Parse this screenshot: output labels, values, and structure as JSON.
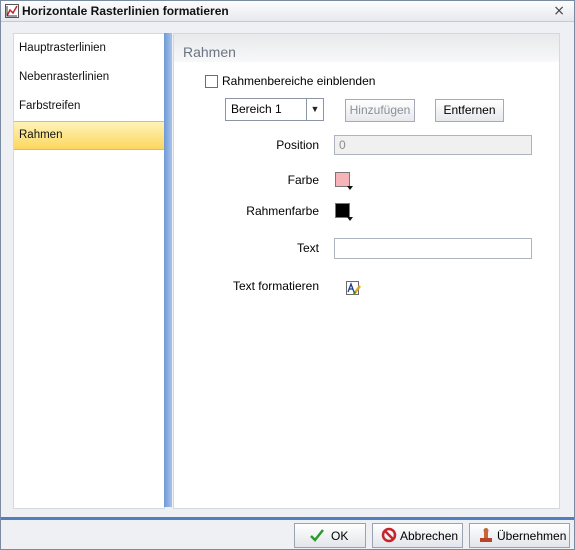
{
  "window": {
    "title": "Horizontale Rasterlinien formatieren",
    "close_glyph": "×"
  },
  "sidebar": {
    "items": [
      {
        "label": "Hauptrasterlinien"
      },
      {
        "label": "Nebenrasterlinien"
      },
      {
        "label": "Farbstreifen"
      },
      {
        "label": "Rahmen",
        "active": true
      }
    ]
  },
  "panel": {
    "title": "Rahmen",
    "show_ranges_label": "Rahmenbereiche einblenden",
    "show_ranges_checked": false,
    "range_select_value": "Bereich 1",
    "add_button": "Hinzufügen",
    "remove_button": "Entfernen",
    "position_label": "Position",
    "position_value": "0",
    "color_label": "Farbe",
    "color_value": "#f7b4b8",
    "border_color_label": "Rahmenfarbe",
    "border_color_value": "#000000",
    "text_label": "Text",
    "text_value": "",
    "text_format_label": "Text formatieren",
    "text_format_icon": "text-format-icon"
  },
  "footer": {
    "ok": "OK",
    "cancel": "Abbrechen",
    "apply": "Übernehmen"
  },
  "colors": {
    "accent": "#4f7fc1",
    "active_nav": "#fbd760"
  }
}
